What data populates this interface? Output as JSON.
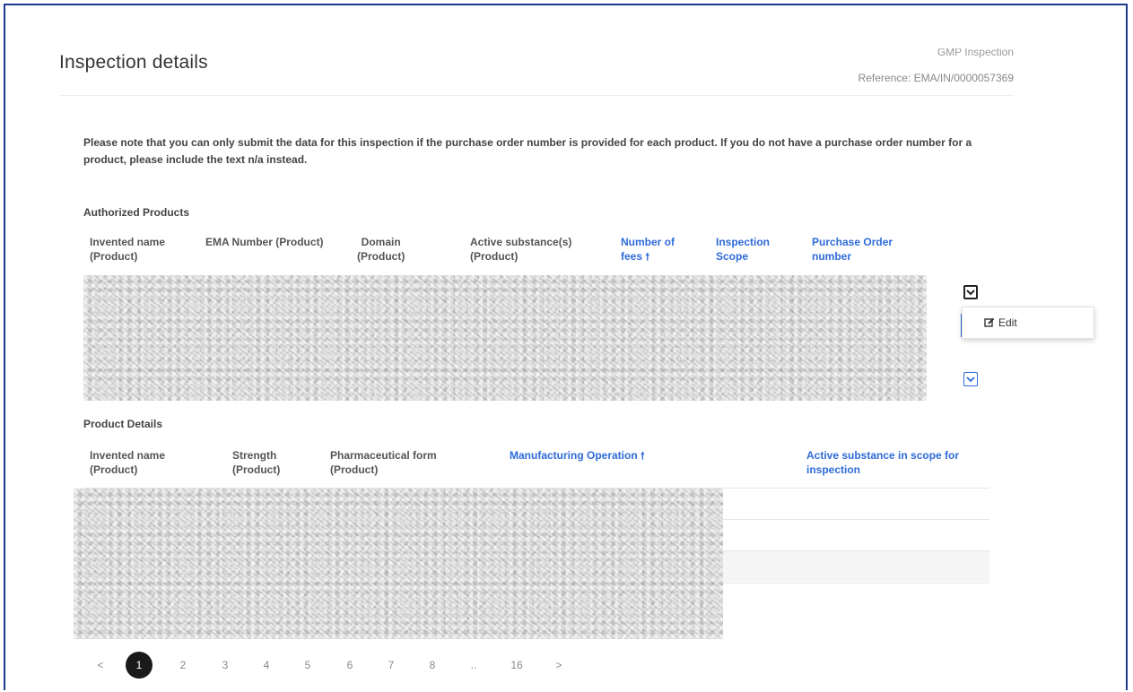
{
  "header": {
    "title": "Inspection details",
    "inspection_type": "GMP Inspection",
    "reference": "Reference: EMA/IN/0000057369"
  },
  "notice": "Please note that you can only submit the data for this inspection if the purchase order number is provided for each product. If you do not have a purchase order number for a product, please include the text n/a instead.",
  "authorized_products": {
    "section_label": "Authorized Products",
    "columns": [
      {
        "line1": "Invented name",
        "line2": "(Product)"
      },
      {
        "line1": "",
        "line2": "EMA Number (Product)"
      },
      {
        "line1": "Domain",
        "line2": "(Product)"
      },
      {
        "line1": "Active substance(s)",
        "line2": "(Product)"
      },
      {
        "line1": "Number of",
        "line2": "fees",
        "sort_arrow": "🠕"
      },
      {
        "line1": "Inspection",
        "line2": "Scope"
      },
      {
        "line1": "Purchase Order",
        "line2": "number"
      }
    ],
    "row_menu": {
      "edit_label": "Edit",
      "edit_icon": "edit-icon"
    }
  },
  "product_details": {
    "section_label": "Product Details",
    "columns": [
      {
        "line1": "Invented name",
        "line2": "(Product)"
      },
      {
        "line1": "Strength",
        "line2": "(Product)"
      },
      {
        "line1": "Pharmaceutical form",
        "line2": "(Product)"
      },
      {
        "line1": "",
        "line2": "Manufacturing Operation",
        "sort_arrow": "🠕"
      },
      {
        "line1": "Active substance in scope for",
        "line2": "inspection"
      }
    ]
  },
  "pagination": {
    "prev": "<",
    "pages": [
      "1",
      "2",
      "3",
      "4",
      "5",
      "6",
      "7",
      "8",
      "..",
      "16"
    ],
    "next": ">",
    "active_page": "1"
  },
  "colors": {
    "accent": "#2f6bd8",
    "frame": "#1e3a8a",
    "active_page_bg": "#1a1a1a"
  }
}
